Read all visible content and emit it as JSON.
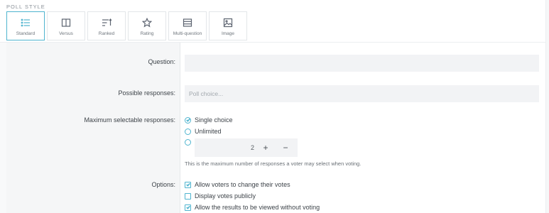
{
  "poll_style": {
    "label": "POLL STYLE",
    "items": [
      {
        "label": "Standard",
        "icon": "list-icon",
        "active": true
      },
      {
        "label": "Versus",
        "icon": "columns-icon",
        "active": false
      },
      {
        "label": "Ranked",
        "icon": "ranked-icon",
        "active": false
      },
      {
        "label": "Rating",
        "icon": "star-icon",
        "active": false
      },
      {
        "label": "Multi-question",
        "icon": "stack-icon",
        "active": false
      },
      {
        "label": "Image",
        "icon": "image-icon",
        "active": false
      }
    ]
  },
  "form": {
    "question": {
      "label": "Question:",
      "value": "",
      "placeholder": ""
    },
    "responses": {
      "label": "Possible responses:",
      "value": "",
      "placeholder": "Poll choice..."
    },
    "max_selectable": {
      "label": "Maximum selectable responses:",
      "options": [
        {
          "label": "Single choice",
          "selected": true
        },
        {
          "label": "Unlimited",
          "selected": false
        }
      ],
      "custom_value": "2",
      "plus": "+",
      "minus": "−",
      "hint": "This is the maximum number of responses a voter may select when voting."
    },
    "options": {
      "label": "Options:",
      "items": [
        {
          "label": "Allow voters to change their votes",
          "checked": true
        },
        {
          "label": "Display votes publicly",
          "checked": false
        },
        {
          "label": "Allow the results to be viewed without voting",
          "checked": true
        }
      ]
    }
  },
  "colors": {
    "accent": "#4fb4cf",
    "label_bg": "#f5f6f7",
    "input_bg": "#f2f3f5"
  }
}
